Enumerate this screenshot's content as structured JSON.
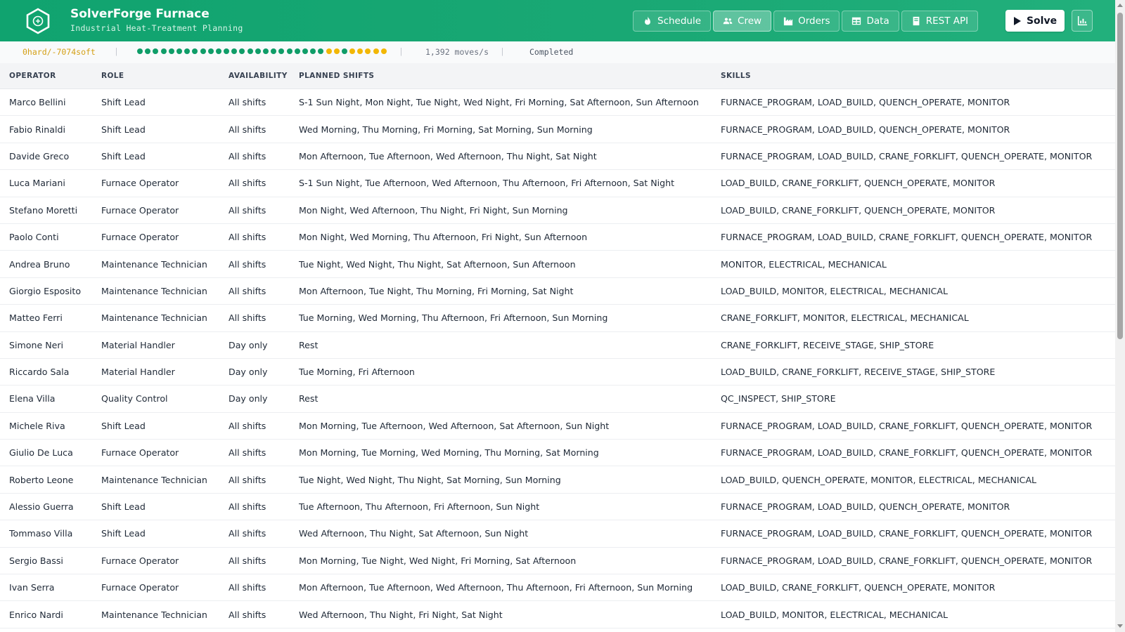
{
  "header": {
    "title": "SolverForge Furnace",
    "subtitle": "Industrial Heat-Treatment Planning",
    "nav": [
      {
        "label": "Schedule",
        "icon": "flame-icon"
      },
      {
        "label": "Crew",
        "icon": "users-icon",
        "active": true
      },
      {
        "label": "Orders",
        "icon": "industry-icon"
      },
      {
        "label": "Data",
        "icon": "table-icon"
      },
      {
        "label": "REST API",
        "icon": "book-icon"
      }
    ],
    "solve_label": "Solve",
    "chart_icon": "chart-bar-icon",
    "accent_color": "#10a36f"
  },
  "status": {
    "score": "0hard/-7074soft",
    "moves": "1,392 moves/s",
    "state": "Completed",
    "dots": [
      "g",
      "g",
      "g",
      "g",
      "g",
      "g",
      "g",
      "g",
      "g",
      "g",
      "g",
      "g",
      "g",
      "g",
      "g",
      "g",
      "g",
      "g",
      "g",
      "g",
      "g",
      "g",
      "g",
      "g",
      "y",
      "y",
      "g",
      "y",
      "y",
      "y",
      "y",
      "y"
    ]
  },
  "table": {
    "headers": [
      "OPERATOR",
      "ROLE",
      "AVAILABILITY",
      "PLANNED SHIFTS",
      "SKILLS"
    ],
    "rows": [
      [
        "Marco Bellini",
        "Shift Lead",
        "All shifts",
        "S-1 Sun Night, Mon Night, Tue Night, Wed Night, Fri Morning, Sat Afternoon, Sun Afternoon",
        "FURNACE_PROGRAM, LOAD_BUILD, QUENCH_OPERATE, MONITOR"
      ],
      [
        "Fabio Rinaldi",
        "Shift Lead",
        "All shifts",
        "Wed Morning, Thu Morning, Fri Morning, Sat Morning, Sun Morning",
        "FURNACE_PROGRAM, LOAD_BUILD, QUENCH_OPERATE, MONITOR"
      ],
      [
        "Davide Greco",
        "Shift Lead",
        "All shifts",
        "Mon Afternoon, Tue Afternoon, Wed Afternoon, Thu Night, Sat Night",
        "FURNACE_PROGRAM, LOAD_BUILD, CRANE_FORKLIFT, QUENCH_OPERATE, MONITOR"
      ],
      [
        "Luca Mariani",
        "Furnace Operator",
        "All shifts",
        "S-1 Sun Night, Tue Afternoon, Wed Afternoon, Thu Afternoon, Fri Afternoon, Sat Night",
        "LOAD_BUILD, CRANE_FORKLIFT, QUENCH_OPERATE, MONITOR"
      ],
      [
        "Stefano Moretti",
        "Furnace Operator",
        "All shifts",
        "Mon Night, Wed Afternoon, Thu Night, Fri Night, Sun Morning",
        "LOAD_BUILD, CRANE_FORKLIFT, QUENCH_OPERATE, MONITOR"
      ],
      [
        "Paolo Conti",
        "Furnace Operator",
        "All shifts",
        "Mon Night, Wed Morning, Thu Afternoon, Fri Night, Sun Afternoon",
        "FURNACE_PROGRAM, LOAD_BUILD, CRANE_FORKLIFT, QUENCH_OPERATE, MONITOR"
      ],
      [
        "Andrea Bruno",
        "Maintenance Technician",
        "All shifts",
        "Tue Night, Wed Night, Thu Night, Sat Afternoon, Sun Afternoon",
        "MONITOR, ELECTRICAL, MECHANICAL"
      ],
      [
        "Giorgio Esposito",
        "Maintenance Technician",
        "All shifts",
        "Mon Afternoon, Tue Night, Thu Morning, Fri Morning, Sat Night",
        "LOAD_BUILD, MONITOR, ELECTRICAL, MECHANICAL"
      ],
      [
        "Matteo Ferri",
        "Maintenance Technician",
        "All shifts",
        "Tue Morning, Wed Morning, Thu Afternoon, Fri Afternoon, Sun Morning",
        "CRANE_FORKLIFT, MONITOR, ELECTRICAL, MECHANICAL"
      ],
      [
        "Simone Neri",
        "Material Handler",
        "Day only",
        "Rest",
        "CRANE_FORKLIFT, RECEIVE_STAGE, SHIP_STORE"
      ],
      [
        "Riccardo Sala",
        "Material Handler",
        "Day only",
        "Tue Morning, Fri Afternoon",
        "LOAD_BUILD, CRANE_FORKLIFT, RECEIVE_STAGE, SHIP_STORE"
      ],
      [
        "Elena Villa",
        "Quality Control",
        "Day only",
        "Rest",
        "QC_INSPECT, SHIP_STORE"
      ],
      [
        "Michele Riva",
        "Shift Lead",
        "All shifts",
        "Mon Morning, Tue Afternoon, Wed Afternoon, Sat Afternoon, Sun Night",
        "FURNACE_PROGRAM, LOAD_BUILD, CRANE_FORKLIFT, QUENCH_OPERATE, MONITOR"
      ],
      [
        "Giulio De Luca",
        "Furnace Operator",
        "All shifts",
        "Mon Morning, Tue Morning, Wed Morning, Thu Morning, Sat Morning",
        "FURNACE_PROGRAM, LOAD_BUILD, CRANE_FORKLIFT, QUENCH_OPERATE, MONITOR"
      ],
      [
        "Roberto Leone",
        "Maintenance Technician",
        "All shifts",
        "Tue Night, Wed Night, Thu Night, Sat Morning, Sun Morning",
        "LOAD_BUILD, QUENCH_OPERATE, MONITOR, ELECTRICAL, MECHANICAL"
      ],
      [
        "Alessio Guerra",
        "Shift Lead",
        "All shifts",
        "Tue Afternoon, Thu Afternoon, Fri Afternoon, Sun Night",
        "FURNACE_PROGRAM, LOAD_BUILD, QUENCH_OPERATE, MONITOR"
      ],
      [
        "Tommaso Villa",
        "Shift Lead",
        "All shifts",
        "Wed Afternoon, Thu Night, Sat Afternoon, Sun Night",
        "FURNACE_PROGRAM, LOAD_BUILD, CRANE_FORKLIFT, QUENCH_OPERATE, MONITOR"
      ],
      [
        "Sergio Bassi",
        "Furnace Operator",
        "All shifts",
        "Mon Morning, Tue Night, Wed Night, Fri Morning, Sat Afternoon",
        "FURNACE_PROGRAM, LOAD_BUILD, CRANE_FORKLIFT, QUENCH_OPERATE, MONITOR"
      ],
      [
        "Ivan Serra",
        "Furnace Operator",
        "All shifts",
        "Mon Afternoon, Tue Afternoon, Wed Afternoon, Thu Afternoon, Fri Afternoon, Sun Morning",
        "LOAD_BUILD, CRANE_FORKLIFT, QUENCH_OPERATE, MONITOR"
      ],
      [
        "Enrico Nardi",
        "Maintenance Technician",
        "All shifts",
        "Wed Afternoon, Thu Night, Fri Night, Sat Night",
        "LOAD_BUILD, MONITOR, ELECTRICAL, MECHANICAL"
      ]
    ]
  }
}
